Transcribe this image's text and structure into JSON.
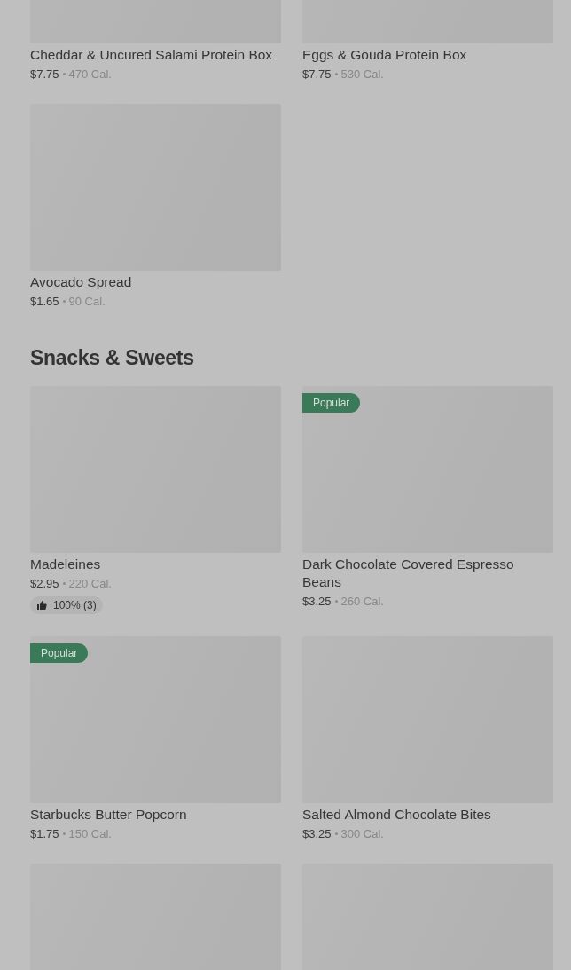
{
  "sections": [
    {
      "items": [
        {
          "kind": "product",
          "name": "Cheddar & Uncured Salami Protein Box",
          "price": "$7.75",
          "calories": "470 Cal."
        },
        {
          "kind": "product",
          "name": "Eggs & Gouda Protein Box",
          "price": "$7.75",
          "calories": "530 Cal."
        },
        {
          "kind": "product",
          "name": "Avocado Spread",
          "price": "$1.65",
          "calories": "90 Cal."
        }
      ]
    },
    {
      "title": "Snacks & Sweets",
      "items": [
        {
          "kind": "product",
          "name": "Madeleines",
          "price": "$2.95",
          "calories": "220 Cal.",
          "rating": "100% (3)"
        },
        {
          "kind": "product",
          "name": "Dark Chocolate Covered Espresso Beans",
          "price": "$3.25",
          "calories": "260 Cal.",
          "badge": "Popular"
        },
        {
          "kind": "product",
          "name": "Starbucks Butter Popcorn",
          "price": "$1.75",
          "calories": "150 Cal.",
          "badge": "Popular"
        },
        {
          "kind": "product",
          "name": "Salted Almond Chocolate Bites",
          "price": "$3.25",
          "calories": "300 Cal."
        },
        {
          "kind": "image_only"
        },
        {
          "kind": "image_only"
        }
      ]
    }
  ]
}
